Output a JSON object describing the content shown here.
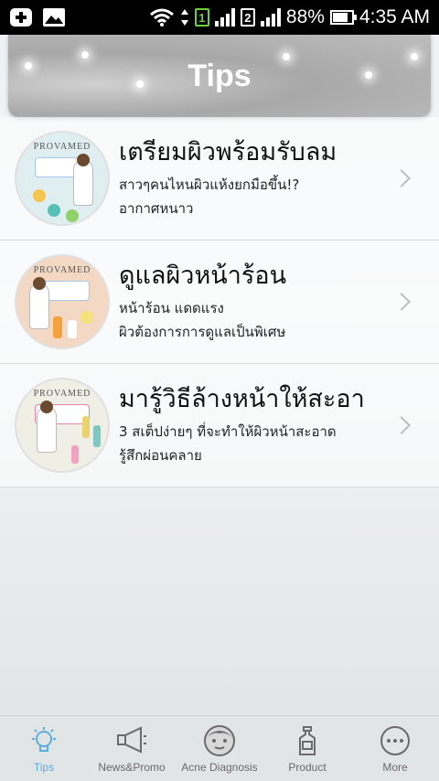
{
  "status_bar": {
    "sim1": "1",
    "sim2": "2",
    "battery": "88%",
    "time": "4:35 AM"
  },
  "header": {
    "title": "Tips"
  },
  "tips": [
    {
      "thumb_brand": "PROVAMED",
      "title": "เตรียมผิวพร้อมรับลม",
      "line1": "สาวๆคนไหนผิวแห้งยกมือขึ้น!?",
      "line2": "อากาศหนาว"
    },
    {
      "thumb_brand": "PROVAMED",
      "title": "ดูแลผิวหน้าร้อน",
      "line1": "หน้าร้อน แดดแรง",
      "line2": "ผิวต้องการการดูแลเป็นพิเศษ"
    },
    {
      "thumb_brand": "PROVAMED",
      "title": "มารู้วิธีล้างหน้าให้สะอา",
      "line1": "3 สเต็ปง่ายๆ ที่จะทำให้ผิวหน้าสะอาด",
      "line2": "รู้สึกผ่อนคลาย"
    }
  ],
  "nav": {
    "tips": "Tips",
    "news": "News&Promo",
    "acne": "Acne Diagnosis",
    "product": "Product",
    "more": "More"
  },
  "colors": {
    "active_nav": "#5aaedc",
    "inactive_nav": "#6a6a6a"
  }
}
